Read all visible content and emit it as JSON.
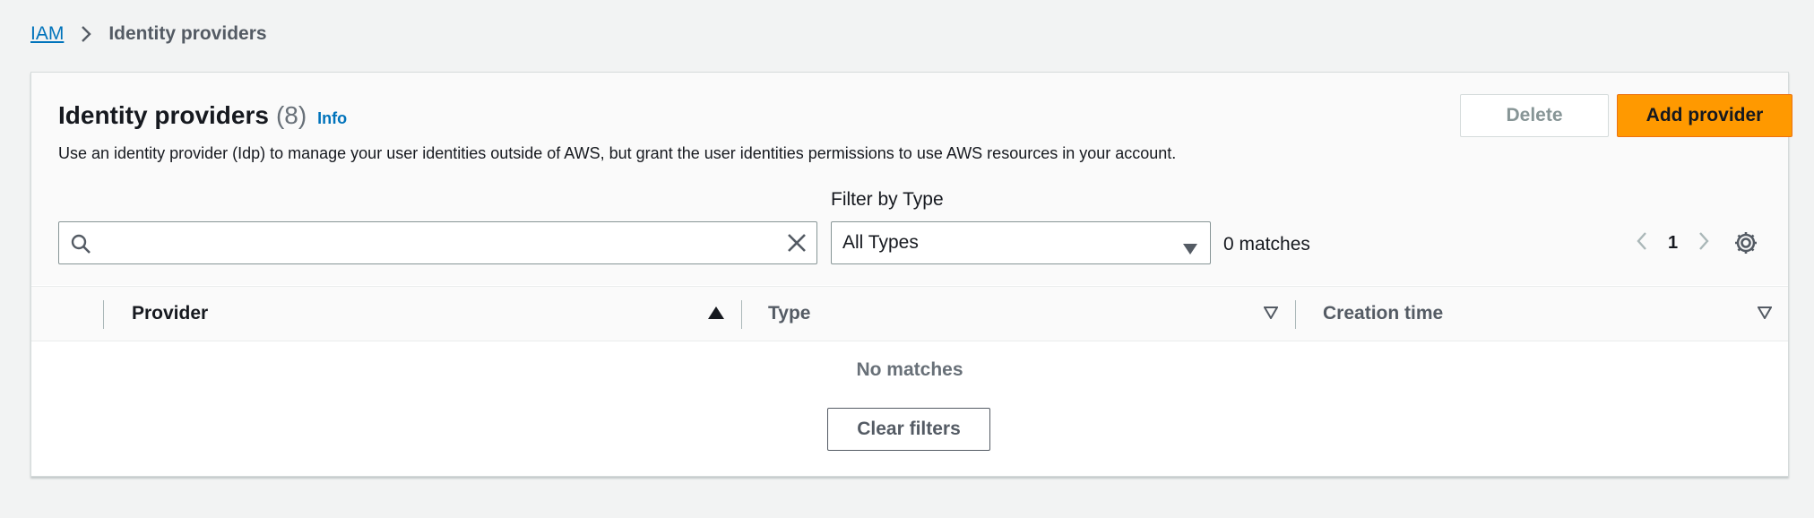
{
  "breadcrumb": {
    "root": "IAM",
    "current": "Identity providers"
  },
  "header": {
    "title": "Identity providers",
    "count": "(8)",
    "info_link": "Info",
    "description": "Use an identity provider (Idp) to manage your user identities outside of AWS, but grant the user identities permissions to use AWS resources in your account.",
    "delete_label": "Delete",
    "add_label": "Add provider"
  },
  "filter": {
    "search_value": "",
    "search_placeholder": "",
    "type_label": "Filter by Type",
    "type_selected": "All Types",
    "matches": "0 matches"
  },
  "pagination": {
    "current_page": "1"
  },
  "table": {
    "columns": [
      "Provider",
      "Type",
      "Creation time"
    ],
    "empty_text": "No matches",
    "clear_filters_label": "Clear filters"
  },
  "colors": {
    "accent": "#ff9900",
    "link": "#0073bb",
    "background": "#f2f3f3"
  },
  "icons": [
    "chevron-right-icon",
    "search-icon",
    "close-icon",
    "caret-down-icon",
    "chevron-left-icon",
    "gear-icon",
    "sort-ascending-icon",
    "sort-icon"
  ]
}
